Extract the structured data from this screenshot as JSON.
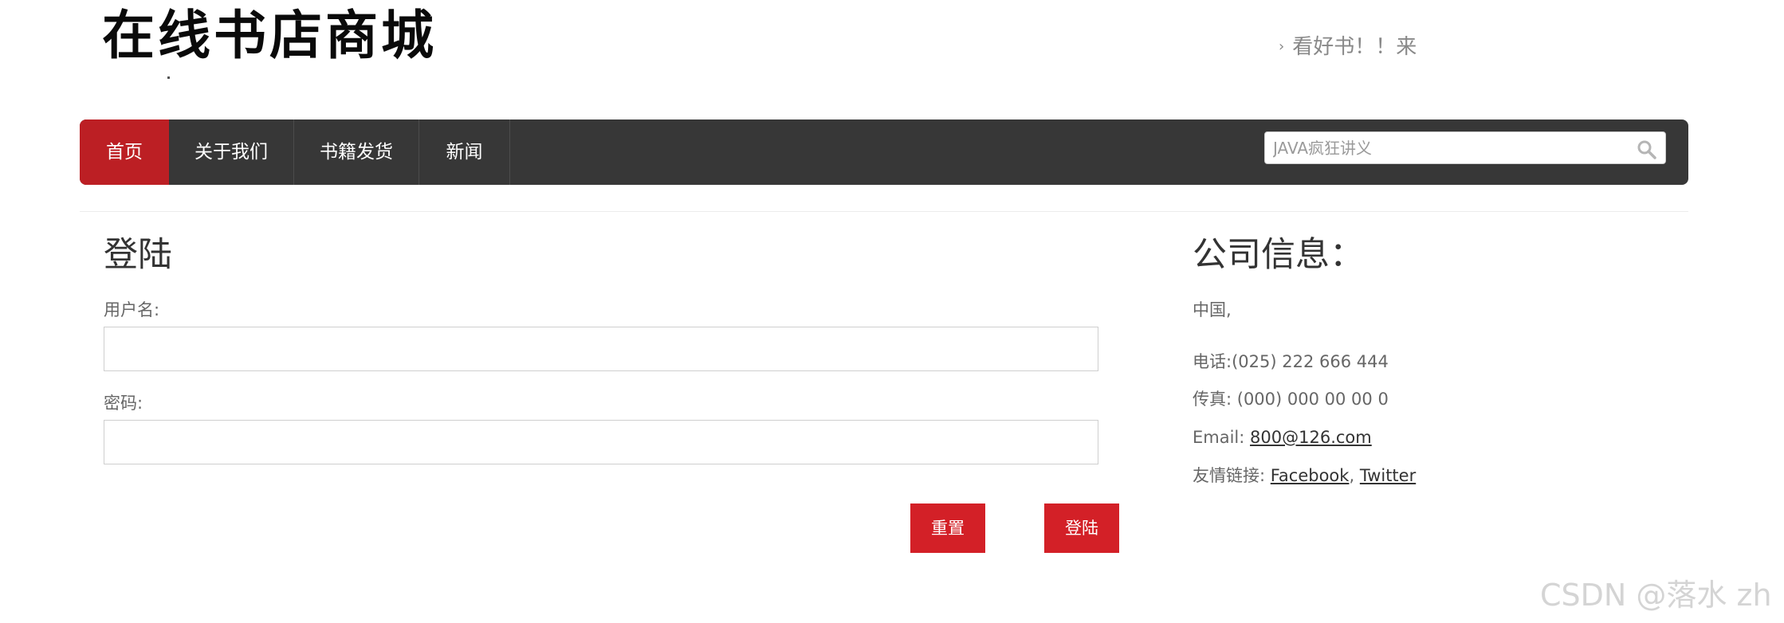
{
  "header": {
    "logo_text": "在线书店商城",
    "tagline": "看好书！！来"
  },
  "nav": {
    "items": [
      {
        "label": "首页",
        "active": true
      },
      {
        "label": "关于我们",
        "active": false
      },
      {
        "label": "书籍发货",
        "active": false
      },
      {
        "label": "新闻",
        "active": false
      }
    ],
    "search": {
      "placeholder": "JAVA疯狂讲义",
      "icon": "search-icon"
    },
    "colors": {
      "bar": "#373737",
      "active": "#bc1f24"
    }
  },
  "login": {
    "title": "登陆",
    "username_label": "用户名:",
    "username_value": "",
    "password_label": "密码:",
    "password_value": "",
    "reset_label": "重置",
    "submit_label": "登陆",
    "button_color": "#d32027"
  },
  "company": {
    "title": "公司信息：",
    "address": "中国,",
    "phone": "电话:(025) 222 666 444",
    "fax": "传真: (000) 000 00 00 0",
    "email_label": "Email:",
    "email": "800@126.com",
    "links_label": "友情链接:",
    "link_facebook": "Facebook",
    "link_separator": ",",
    "link_twitter": "Twitter"
  },
  "watermark": "CSDN @落水 zh"
}
